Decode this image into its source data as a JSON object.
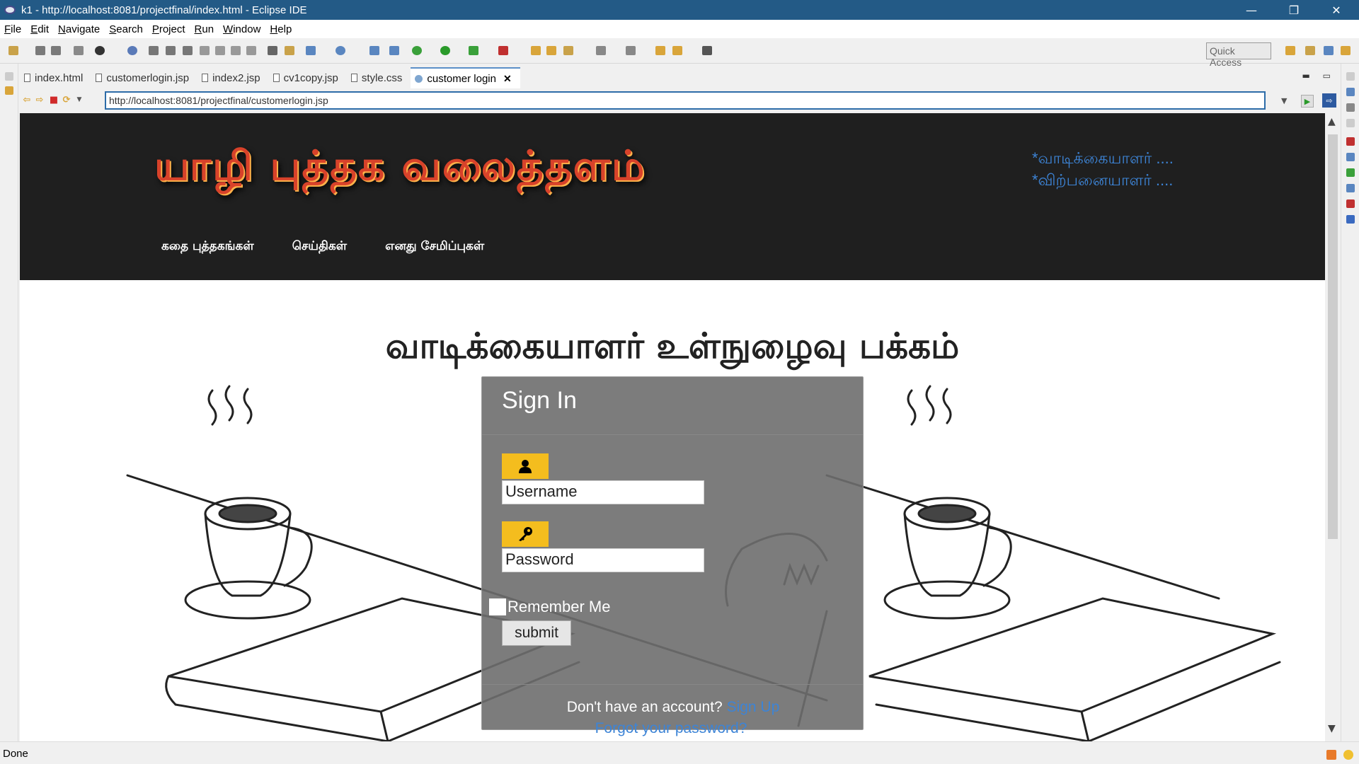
{
  "window": {
    "title": "k1 - http://localhost:8081/projectfinal/index.html - Eclipse IDE",
    "controls": {
      "minimize": "—",
      "maximize": "❐",
      "close": "✕"
    }
  },
  "menubar": [
    "File",
    "Edit",
    "Navigate",
    "Search",
    "Project",
    "Run",
    "Window",
    "Help"
  ],
  "toolbar": {
    "quick_access": "Quick Access"
  },
  "tabs": [
    {
      "label": "index.html",
      "icon": "file-icon",
      "active": false
    },
    {
      "label": "customerlogin.jsp",
      "icon": "file-icon",
      "active": false
    },
    {
      "label": "index2.jsp",
      "icon": "file-icon",
      "active": false
    },
    {
      "label": "cv1copy.jsp",
      "icon": "file-icon",
      "active": false
    },
    {
      "label": "style.css",
      "icon": "file-icon",
      "active": false
    },
    {
      "label": "customer login",
      "icon": "globe-icon",
      "active": true
    }
  ],
  "browser": {
    "url": "http://localhost:8081/projectfinal/customerlogin.jsp"
  },
  "site": {
    "logo": "யாழி புத்தக வலைத்தளம்",
    "top_links": [
      "*வாடிக்கையாளர் ....",
      "*விற்பனையாளர் ...."
    ],
    "nav": [
      "கதை புத்தகங்கள்",
      "செய்திகள்",
      "எனது சேமிப்புகள்"
    ],
    "heading": "வாடிக்கையாளர் உள்நுழைவு பக்கம்"
  },
  "login": {
    "title": "Sign In",
    "username_placeholder": "Username",
    "password_placeholder": "Password",
    "remember": "Remember Me",
    "submit": "submit",
    "no_account": "Don't have an account?",
    "signup": "Sign Up",
    "forgot": "Forgot your password?"
  },
  "status": {
    "text": "Done"
  },
  "colors": {
    "titlebar": "#235a86",
    "header_bg": "#1f1f1f",
    "link": "#3d84d6",
    "badge": "#f4bd1e",
    "logo": "#d8422a"
  }
}
